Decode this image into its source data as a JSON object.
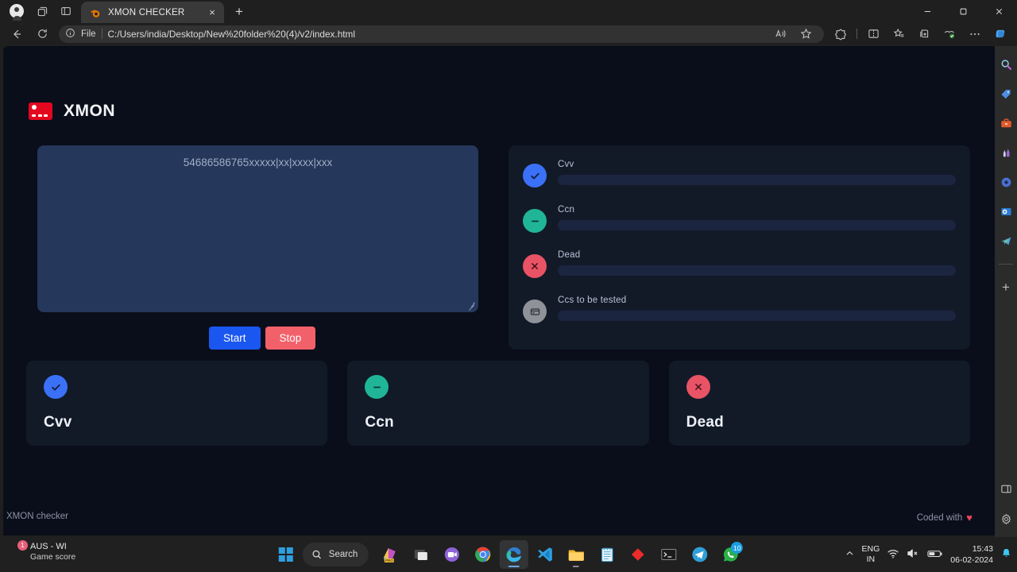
{
  "browser": {
    "tab": {
      "title": "XMON CHECKER",
      "favicon": "blender-icon",
      "close_label": "×"
    },
    "newtab_label": "+",
    "window_controls": {
      "minimize": "–",
      "maximize": "❐",
      "close": "✕"
    },
    "nav": {
      "back": "←",
      "reload": "⟳"
    },
    "omnibox": {
      "info_icon": "info-icon",
      "scheme_label": "File",
      "url": "C:/Users/india/Desktop/New%20folder%20(4)/v2/index.html",
      "read_aloud": "Aᴰ",
      "favorite": "☆"
    },
    "toolbar_icons": [
      "browser-essentials-icon",
      "split-screen-icon",
      "favorites-icon",
      "collections-icon",
      "shopping-icon",
      "settings-more-icon",
      "copilot-icon"
    ]
  },
  "edge_sidebar": {
    "items": [
      "search-icon",
      "shopping-tag-icon",
      "briefcase-icon",
      "games-icon",
      "copilot-icon",
      "outlook-icon",
      "telegram-icon"
    ],
    "add_label": "+",
    "bottom": [
      "sidebar-toggle-icon",
      "settings-gear-icon"
    ]
  },
  "app": {
    "brand": {
      "name": "XMON",
      "logo": "credit-card-icon"
    },
    "input": {
      "placeholder": "54686586765xxxxx|xx|xxxx|xxx",
      "value": ""
    },
    "buttons": {
      "start": "Start",
      "stop": "Stop"
    },
    "status_panel": {
      "rows": [
        {
          "label": "Cvv",
          "icon": "check-icon",
          "color": "#3b71f7",
          "badge_class": "b-blue"
        },
        {
          "label": "Ccn",
          "icon": "minus-icon",
          "color": "#20b596",
          "badge_class": "b-teal"
        },
        {
          "label": "Dead",
          "icon": "close-icon",
          "color": "#e85365",
          "badge_class": "b-red"
        },
        {
          "label": "Ccs to be tested",
          "icon": "card-icon",
          "color": "#8f9298",
          "badge_class": "b-gray"
        }
      ]
    },
    "cards": [
      {
        "title": "Cvv",
        "icon": "check-icon",
        "color": "#3b71f7",
        "badge_class": "b-blue"
      },
      {
        "title": "Ccn",
        "icon": "minus-icon",
        "color": "#20b596",
        "badge_class": "b-teal"
      },
      {
        "title": "Dead",
        "icon": "close-icon",
        "color": "#e85365",
        "badge_class": "b-red"
      }
    ],
    "footer": {
      "left": "XMON checker",
      "right": "Coded with",
      "heart": "♥"
    }
  },
  "taskbar": {
    "widget": {
      "title": "AUS - WI",
      "subtitle": "Game score",
      "badge": "1"
    },
    "search_placeholder": "Search",
    "start_label": "windows-start-icon",
    "apps": [
      "widgets-icon",
      "pro-app-icon",
      "window-app-icon",
      "meet-icon",
      "chrome-icon",
      "edge-icon",
      "vscode-icon",
      "file-explorer-icon",
      "notepad-icon",
      "red-diamond-icon",
      "terminal-icon",
      "telegram-icon",
      "whatsapp-icon"
    ],
    "whatsapp_badge": "10",
    "tray": {
      "overflow": "⌃",
      "language": "ENG",
      "region": "IN",
      "wifi": "wifi-icon",
      "volume": "volume-muted-icon",
      "battery": "battery-icon",
      "time": "15:43",
      "date": "06-02-2024",
      "notifications": "bell-icon"
    }
  }
}
